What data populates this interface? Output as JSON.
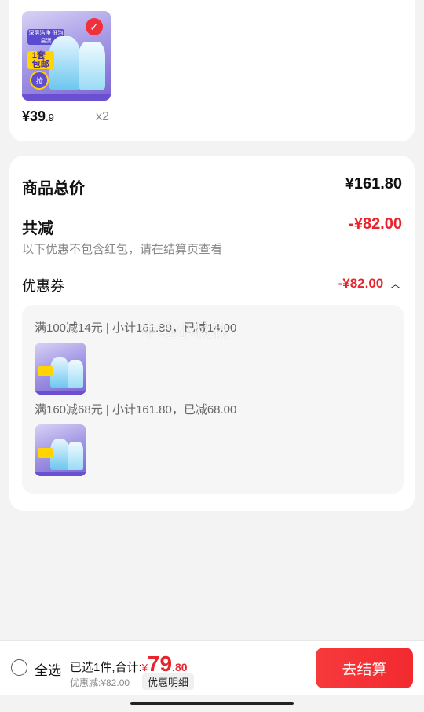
{
  "product": {
    "price_prefix": "¥",
    "price_int": "39",
    "price_dec": ".9",
    "quantity": "x2",
    "thumb_badge": "1套\n包邮",
    "thumb_grab": "抢",
    "thumb_banner": "深层洁净 低泡易漂"
  },
  "summary": {
    "total_label": "商品总价",
    "total_value": "¥161.80",
    "discount_label": "共减",
    "discount_value": "-¥82.00",
    "note": "以下优惠不包含红包，请在结算页查看",
    "coupon_label": "优惠券",
    "coupon_value": "-¥82.00",
    "coupon_rules": [
      {
        "text": "满100减14元 | 小计161.80，已减14.00"
      },
      {
        "text": "满160减68元 | 小计161.80，已减68.00"
      }
    ],
    "watermark": "牛毛小秋秋"
  },
  "footer": {
    "select_all": "全选",
    "selected_text": "已选1件,合计:",
    "total_prefix": "¥",
    "total_int": "79",
    "total_dec": ".80",
    "discount_text": "优惠减:¥82.00",
    "detail_label": "优惠明细",
    "pay_label": "去结算"
  },
  "colors": {
    "accent_red": "#e9242c",
    "pay_button": "#f22a2f",
    "background": "#f3f3f3"
  }
}
